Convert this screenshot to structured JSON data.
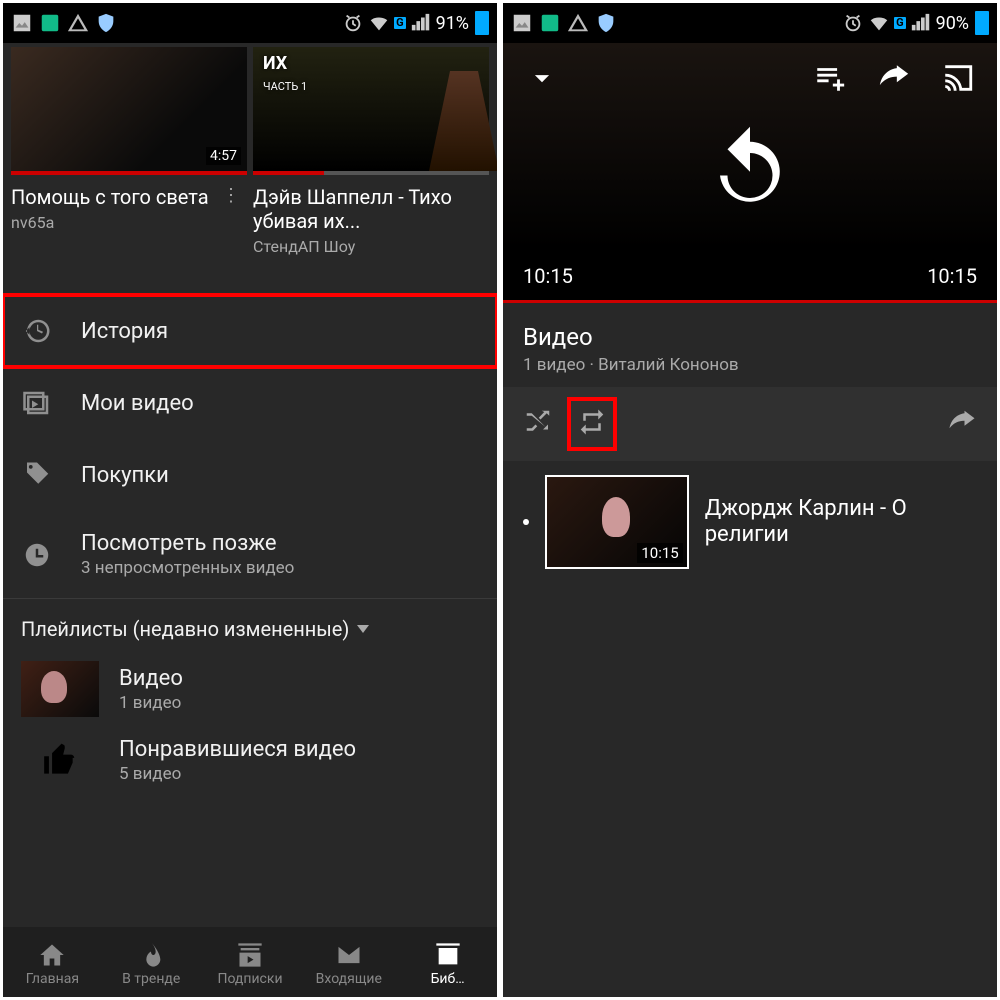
{
  "left": {
    "status": {
      "battery": "91%"
    },
    "videos": [
      {
        "title": "Помощь с того света",
        "channel": "nv65a",
        "duration": "4:57"
      },
      {
        "title": "Дэйв Шаппелл - Тихо убивая их...",
        "channel": "СтендАП Шоу",
        "overlay": "ИХ",
        "part": "ЧАСТЬ 1"
      }
    ],
    "library": {
      "history": "История",
      "my_videos": "Мои видео",
      "purchases": "Покупки",
      "watch_later": "Посмотреть позже",
      "watch_later_sub": "3 непросмотренных видео"
    },
    "playlists_header": "Плейлисты (недавно измененные)",
    "playlists": [
      {
        "name": "Видео",
        "count": "1 видео"
      },
      {
        "name": "Понравившиеся видео",
        "count": "5 видео"
      }
    ],
    "nav": {
      "home": "Главная",
      "trending": "В тренде",
      "subs": "Подписки",
      "inbox": "Входящие",
      "library": "Биб…"
    }
  },
  "right": {
    "status": {
      "battery": "90%"
    },
    "player": {
      "time_left": "10:15",
      "time_right": "10:15"
    },
    "playlist": {
      "title": "Видео",
      "subtitle": "1 видео · Виталий Кононов"
    },
    "video": {
      "title": "Джордж Карлин - О религии",
      "duration": "10:15"
    }
  }
}
